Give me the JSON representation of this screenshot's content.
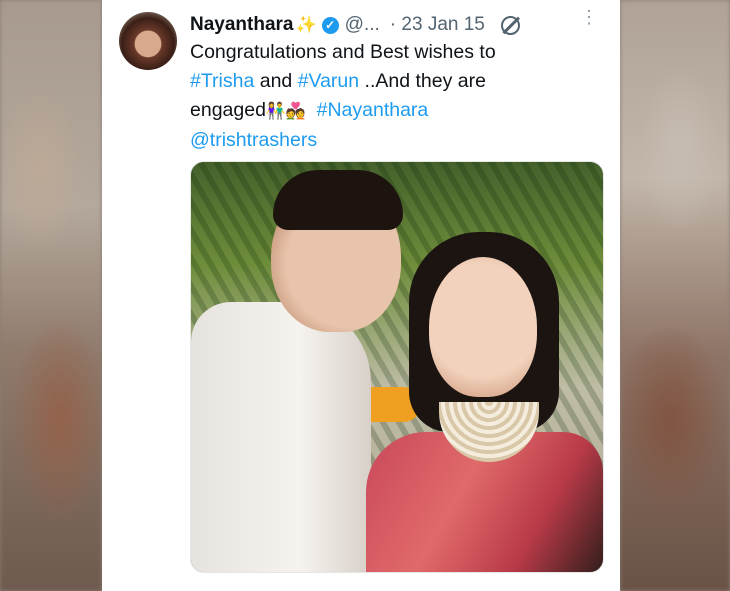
{
  "tweet": {
    "author_name": "Nayanthara",
    "sparkle_emoji": "✨",
    "handle": "@...",
    "separator": "·",
    "date": "23 Jan 15",
    "more_icon": "⋮",
    "text_line1": "Congratulations and Best wishes to",
    "hashtag_trisha": "#Trisha",
    "and_word": " and ",
    "hashtag_varun": "#Varun",
    "text_line2_rest": " ..And they are",
    "text_line3_start": "engaged",
    "emojis": "👫💑",
    "hashtag_nayanthara": "#Nayanthara",
    "mention": "@trishtrashers"
  },
  "colors": {
    "link": "#1d9bf0",
    "text": "#0f1419",
    "muted": "#536471",
    "verified": "#1d9bf0"
  },
  "icons": [
    "avatar",
    "verified-badge-icon",
    "edited-icon",
    "more-options-icon"
  ]
}
